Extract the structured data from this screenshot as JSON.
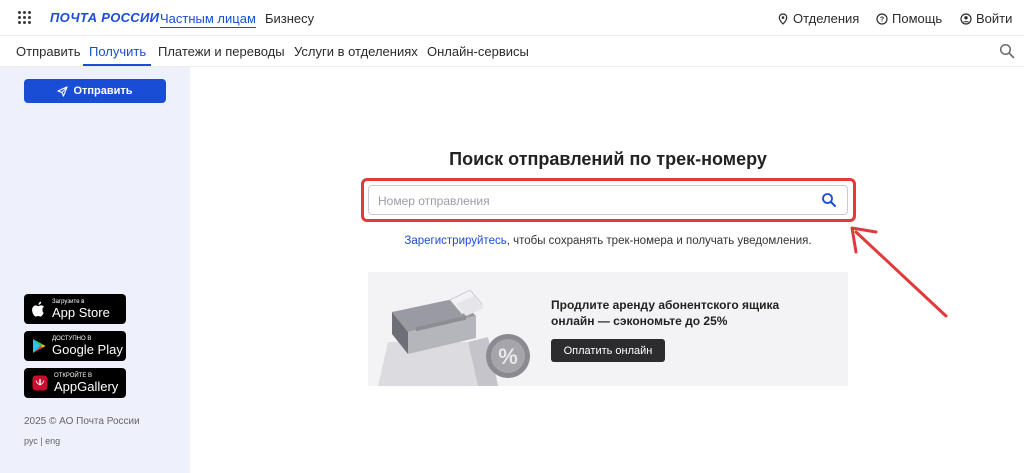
{
  "header": {
    "logo": "ПОЧТА РОССИИ",
    "segments": [
      "Частным лицам",
      "Бизнесу"
    ],
    "right": {
      "offices": "Отделения",
      "help": "Помощь",
      "login": "Войти"
    }
  },
  "nav": {
    "items": [
      "Отправить",
      "Получить",
      "Платежи и переводы",
      "Услуги в отделениях",
      "Онлайн-сервисы"
    ]
  },
  "sidebar": {
    "send_button": "Отправить",
    "stores": [
      {
        "small": "Загрузите в",
        "big": "App Store"
      },
      {
        "small": "ДОСТУПНО В",
        "big": "Google Play"
      },
      {
        "small": "ОТКРОЙТЕ В",
        "big": "AppGallery"
      }
    ],
    "copyright": "2025 © АО Почта России",
    "langs": "рус | eng"
  },
  "main": {
    "title": "Поиск отправлений по трек-номеру",
    "search_placeholder": "Номер отправления",
    "register_link": "Зарегистрируйтесь",
    "register_rest": ", чтобы сохранять трек-номера и получать уведомления.",
    "promo": {
      "text": "Продлите аренду абонентского ящика онлайн — сэкономьте до 25%",
      "button": "Оплатить онлайн"
    }
  },
  "colors": {
    "brand": "#1a4dd6",
    "highlight": "#e03a3a",
    "sidebar_bg": "#eef0fb"
  }
}
